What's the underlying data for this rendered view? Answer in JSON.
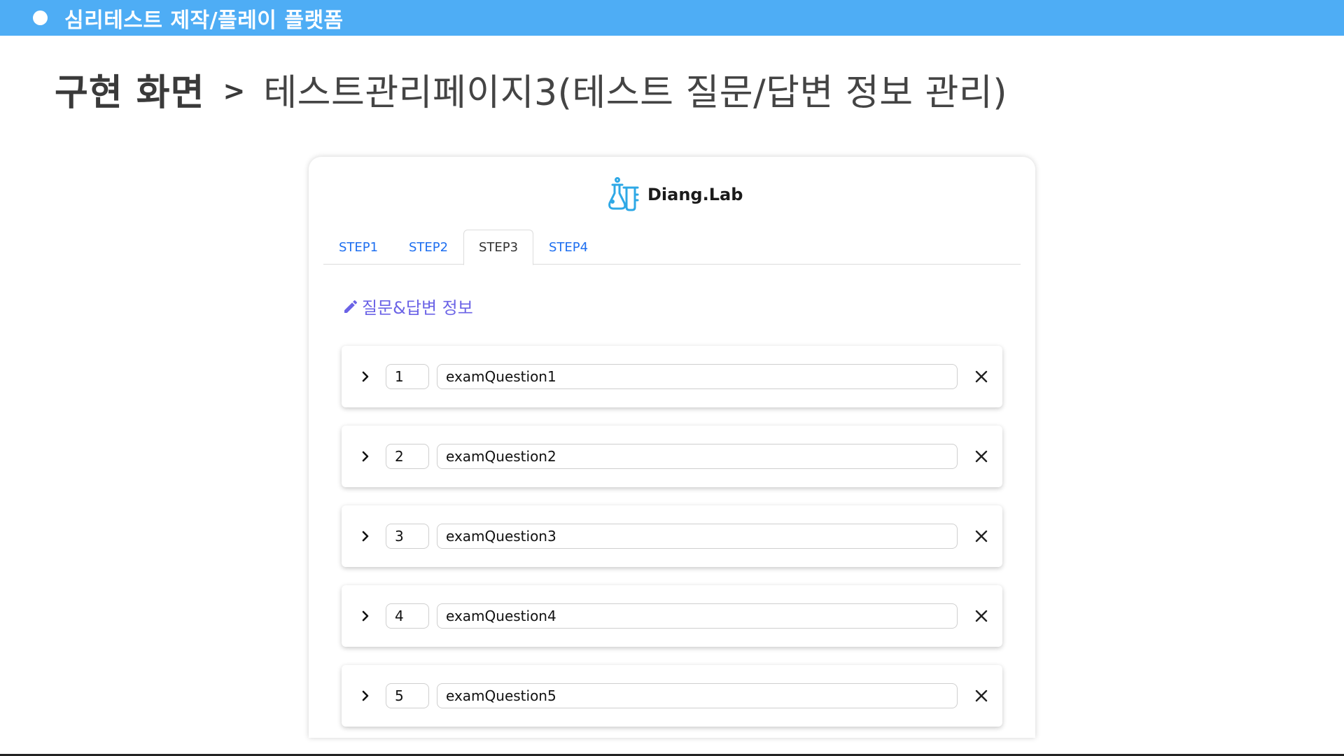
{
  "banner": {
    "title": "심리테스트 제작/플레이 플랫폼"
  },
  "heading": {
    "bold": "구현 화면",
    "separator": ">",
    "subtitle": "테스트관리페이지3(테스트 질문/답변 정보 관리)"
  },
  "app": {
    "logo_text": "Diang.Lab",
    "logo_icon": "flask-beaker-icon",
    "tabs": [
      {
        "label": "STEP1",
        "active": false
      },
      {
        "label": "STEP2",
        "active": false
      },
      {
        "label": "STEP3",
        "active": true
      },
      {
        "label": "STEP4",
        "active": false
      }
    ],
    "section_title": "질문&답변 정보",
    "section_icon": "pencil-icon",
    "questions": [
      {
        "number": "1",
        "text": "examQuestion1"
      },
      {
        "number": "2",
        "text": "examQuestion2"
      },
      {
        "number": "3",
        "text": "examQuestion3"
      },
      {
        "number": "4",
        "text": "examQuestion4"
      },
      {
        "number": "5",
        "text": "examQuestion5"
      }
    ]
  },
  "colors": {
    "banner": "#4eadf5",
    "tab_link": "#1e6ff0",
    "section_title": "#6b63e6",
    "logo_icon": "#2ea8e6"
  }
}
